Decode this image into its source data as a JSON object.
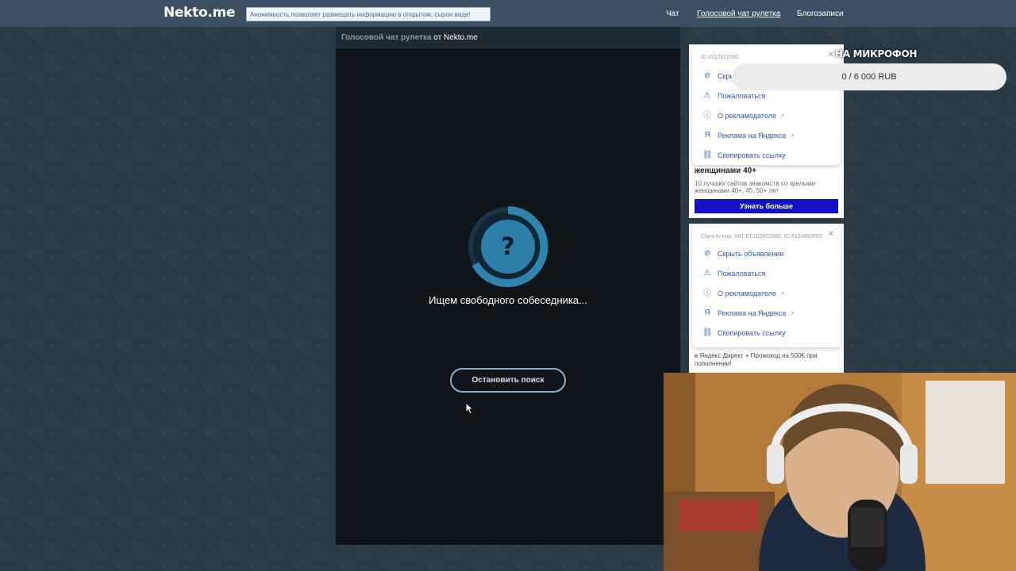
{
  "header": {
    "logo": "Nekto.me",
    "notice": "Анонимность позволяет размещать информацию в открытом, сырон виде!",
    "nav": [
      {
        "label": "Чат",
        "active": false
      },
      {
        "label": "Голосовой чат рулетка",
        "active": true
      },
      {
        "label": "Блогозаписи",
        "active": false
      }
    ]
  },
  "chat": {
    "heading_link": "Голосовой чат рулетка",
    "heading_rest": "от Nekto.me",
    "status": "Ищем свободного собеседника...",
    "stop_button": "Остановить поиск",
    "spinner_symbol": "?"
  },
  "ads": {
    "card1": {
      "id": "ID #312812581",
      "menu": [
        {
          "icon": "eye-off-icon",
          "label": "Скрыть объявление"
        },
        {
          "icon": "warning-icon",
          "label": "Пожаловаться"
        },
        {
          "icon": "info-icon",
          "label": "О рекламодателе",
          "arrow": "↗"
        },
        {
          "icon": "yandex-icon",
          "label": "Реклама на Яндексе",
          "arrow": "↗"
        },
        {
          "icon": "link-icon",
          "label": "Скопировать ссылку"
        }
      ],
      "title": "женщинами 40+",
      "desc": "10 лучших сайтов знакомств со зрелыми женщинами 40+, 45, 50+ лет",
      "cta": "Узнать больше"
    },
    "card2": {
      "id": "Clara Anima, VAT EE102802986, ID #104860083",
      "menu": [
        {
          "icon": "eye-off-icon",
          "label": "Скрыть объявление"
        },
        {
          "icon": "warning-icon",
          "label": "Пожаловаться"
        },
        {
          "icon": "info-icon",
          "label": "О рекламодателе",
          "arrow": "↗"
        },
        {
          "icon": "yandex-icon",
          "label": "Реклама на Яндексе",
          "arrow": "↗"
        },
        {
          "icon": "link-icon",
          "label": "Скопировать ссылку"
        }
      ],
      "foot": "в Яндекс Директ + Промокод на 500€ при пополнении!"
    },
    "close_symbol": "✕"
  },
  "overlay": {
    "title": "НА МИКРОФОН",
    "progress_text": "0 / 6 000 RUB",
    "progress_fraction": 0
  },
  "colors": {
    "header_bg": "#3d5063",
    "chat_bg": "#0f1519",
    "accent": "#2e7da8",
    "cta": "#1310c9"
  }
}
